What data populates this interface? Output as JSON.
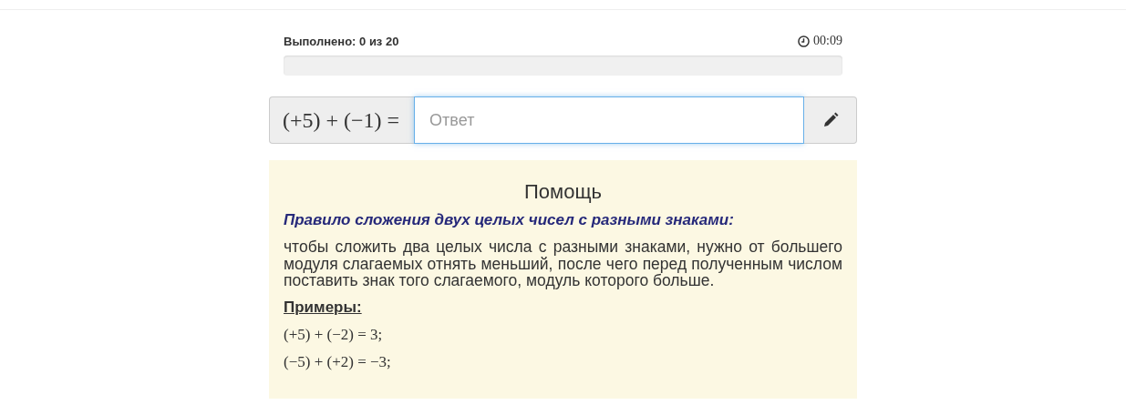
{
  "progress": {
    "label": "Выполнено: 0 из 20",
    "timer": "00:09",
    "level": 0
  },
  "exercise": {
    "expression": "(+5) + (−1) =",
    "answer": {
      "placeholder": "Ответ"
    }
  },
  "help": {
    "title": "Помощь",
    "rule_title": "Правило сложения двух целых чисел с разными знаками:",
    "rule_text": "чтобы сложить два целых числа с разными знаками, нужно от большего модуля слагаемых отнять меньший, после чего перед полученным числом поставить знак того слагаемого, модуль которого больше.",
    "examples_title": "Примеры:",
    "examples": [
      "(+5) + (−2) = 3;",
      "(−5) + (+2) = −3;"
    ]
  }
}
